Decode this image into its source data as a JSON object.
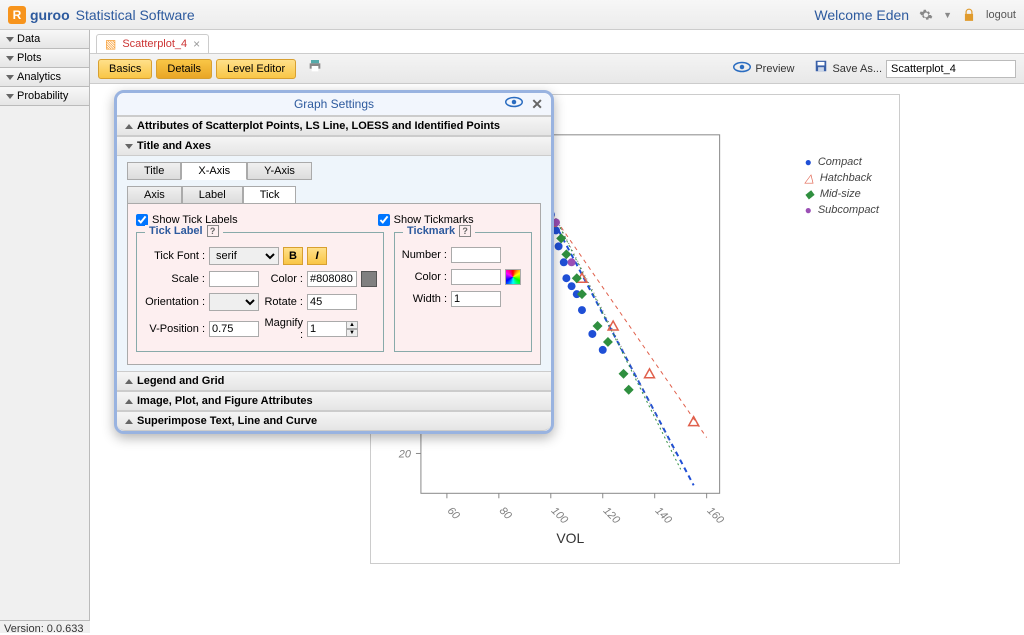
{
  "app": {
    "brand": "guroo",
    "title": "Statistical Software",
    "welcome": "Welcome Eden",
    "logout": "logout"
  },
  "sidebar": {
    "items": [
      "Data",
      "Plots",
      "Analytics",
      "Probability"
    ]
  },
  "tab": {
    "label": "Scatterplot_4"
  },
  "toolbar": {
    "basics": "Basics",
    "details": "Details",
    "level": "Level Editor",
    "preview": "Preview",
    "saveas": "Save As...",
    "saveas_value": "Scatterplot_4"
  },
  "dialog": {
    "title": "Graph Settings",
    "sections": {
      "attrs": "Attributes of Scatterplot Points, LS Line, LOESS and Identified Points",
      "titleaxes": "Title and Axes",
      "legend": "Legend and Grid",
      "image": "Image, Plot, and Figure Attributes",
      "superimpose": "Superimpose Text, Line and Curve"
    },
    "tabs": {
      "title": "Title",
      "xaxis": "X-Axis",
      "yaxis": "Y-Axis"
    },
    "subtabs": {
      "axis": "Axis",
      "label": "Label",
      "tick": "Tick"
    },
    "chk_ticklabels": "Show Tick Labels",
    "chk_tickmarks": "Show Tickmarks",
    "fieldset_ticklabel": "Tick Label",
    "fieldset_tickmark": "Tickmark",
    "lbl_font": "Tick Font :",
    "font_value": "serif",
    "lbl_scale": "Scale :",
    "lbl_color": "Color :",
    "color_value": "#808080",
    "lbl_orientation": "Orientation :",
    "lbl_rotate": "Rotate :",
    "rotate_value": "45",
    "lbl_vpos": "V-Position :",
    "vpos_value": "0.75",
    "lbl_magnify": "Magnify :",
    "magnify_value": "1",
    "lbl_number": "Number :",
    "lbl_tcolor": "Color :",
    "lbl_width": "Width :",
    "width_value": "1"
  },
  "chart_data": {
    "type": "scatter",
    "xlabel": "VOL",
    "x_ticks": [
      60,
      80,
      100,
      120,
      140,
      160
    ],
    "y_visible_ticks": [
      20
    ],
    "legend": [
      "Compact",
      "Hatchback",
      "Mid-size",
      "Subcompact"
    ],
    "legend_colors": {
      "Compact": "#1f4fd6",
      "Hatchback": "#e0604c",
      "Mid-size": "#2f8f3f",
      "Subcompact": "#9b4fb5"
    },
    "series": [
      {
        "name": "Compact",
        "shape": "circle",
        "color": "#1f4fd6",
        "points": [
          [
            95,
            54
          ],
          [
            98,
            52
          ],
          [
            100,
            50
          ],
          [
            102,
            48
          ],
          [
            103,
            46
          ],
          [
            105,
            44
          ],
          [
            106,
            42
          ],
          [
            108,
            41
          ],
          [
            110,
            40
          ],
          [
            112,
            38
          ],
          [
            116,
            35
          ],
          [
            120,
            33
          ]
        ]
      },
      {
        "name": "Hatchback",
        "shape": "triangle",
        "color": "#e0604c",
        "points": [
          [
            90,
            55
          ],
          [
            100,
            49
          ],
          [
            112,
            42
          ],
          [
            124,
            36
          ],
          [
            138,
            30
          ],
          [
            155,
            24
          ]
        ]
      },
      {
        "name": "Mid-size",
        "shape": "diamond",
        "color": "#2f8f3f",
        "points": [
          [
            96,
            52
          ],
          [
            104,
            47
          ],
          [
            106,
            45
          ],
          [
            110,
            42
          ],
          [
            112,
            40
          ],
          [
            118,
            36
          ],
          [
            122,
            34
          ],
          [
            128,
            30
          ],
          [
            130,
            28
          ]
        ]
      },
      {
        "name": "Subcompact",
        "shape": "circle",
        "color": "#9b4fb5",
        "points": [
          [
            102,
            49
          ],
          [
            108,
            44
          ]
        ]
      }
    ]
  },
  "footer": {
    "version": "Version: 0.0.633"
  }
}
